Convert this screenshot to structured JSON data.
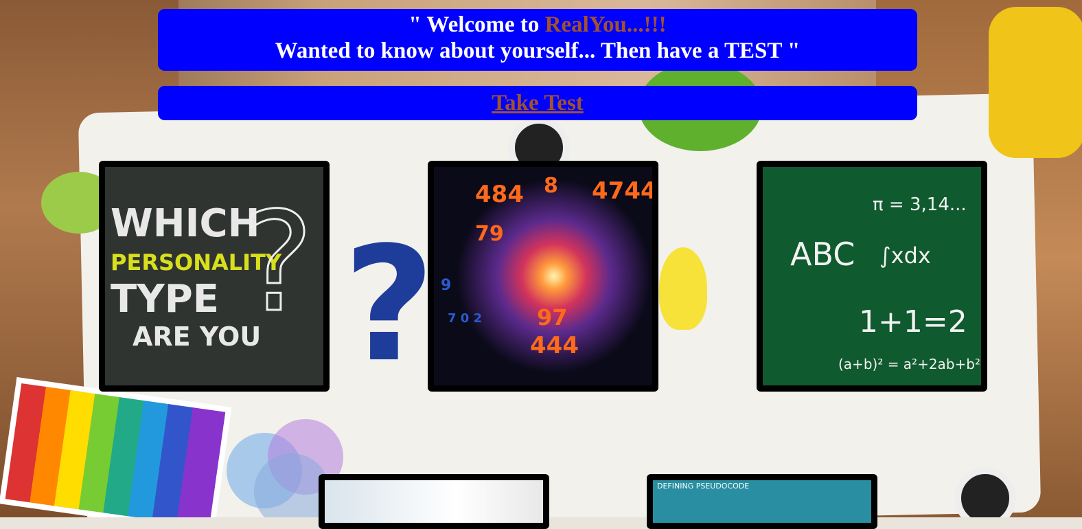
{
  "header": {
    "welcome_prefix": "\" Welcome to ",
    "brand": "RealYou...!!!",
    "tagline": "Wanted to know about yourself... Then have a TEST \""
  },
  "cta": {
    "take_test_label": "Take Test"
  },
  "cards": [
    {
      "name": "personality-type-card",
      "lines": [
        "WHICH",
        "PERSONALITY",
        "TYPE",
        "ARE YOU"
      ]
    },
    {
      "name": "numbers-brain-card"
    },
    {
      "name": "chalkboard-math-card",
      "lines": [
        "π = 3,14...",
        "ABC",
        "∫xdx",
        "1+1=2",
        "(a+b)² = a²+2ab+b²"
      ]
    },
    {
      "name": "classroom-card"
    },
    {
      "name": "pseudocode-card",
      "label": "DEFINING PSEUDOCODE"
    }
  ],
  "colors": {
    "banner": "#0000ff",
    "brand": "#a0522d",
    "banner_text": "#ffffff"
  }
}
